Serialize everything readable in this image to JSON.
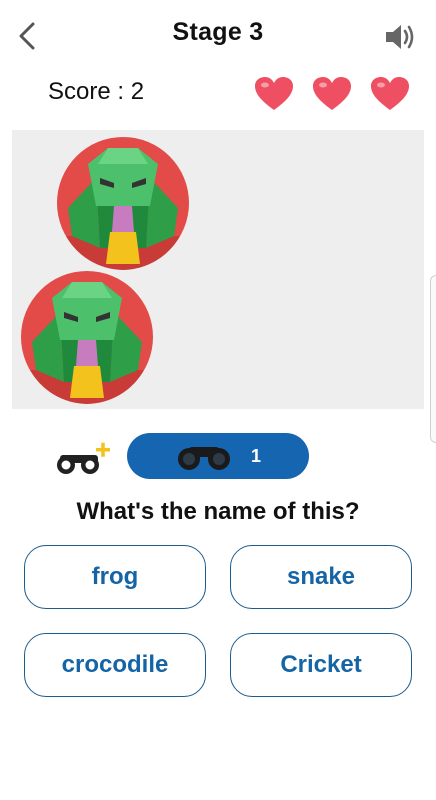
{
  "header": {
    "back_icon": "chevron-left-icon",
    "title": "Stage 3",
    "sound_icon": "speaker-icon"
  },
  "score": {
    "text": "Score : 2",
    "lives": 3,
    "heart_color": "#ef4f63"
  },
  "image": {
    "subject_icon": "snake-icon",
    "background": "#eeeeee"
  },
  "hints": {
    "add_icon": "binoculars-plus-icon",
    "icon": "binoculars-icon",
    "count": "1",
    "pill_color": "#1565b0"
  },
  "question": "What's the name of this?",
  "answers": [
    "frog",
    "snake",
    "crocodile",
    "Cricket"
  ],
  "colors": {
    "answer_text": "#1565a6",
    "answer_border": "#1c5b8c"
  }
}
